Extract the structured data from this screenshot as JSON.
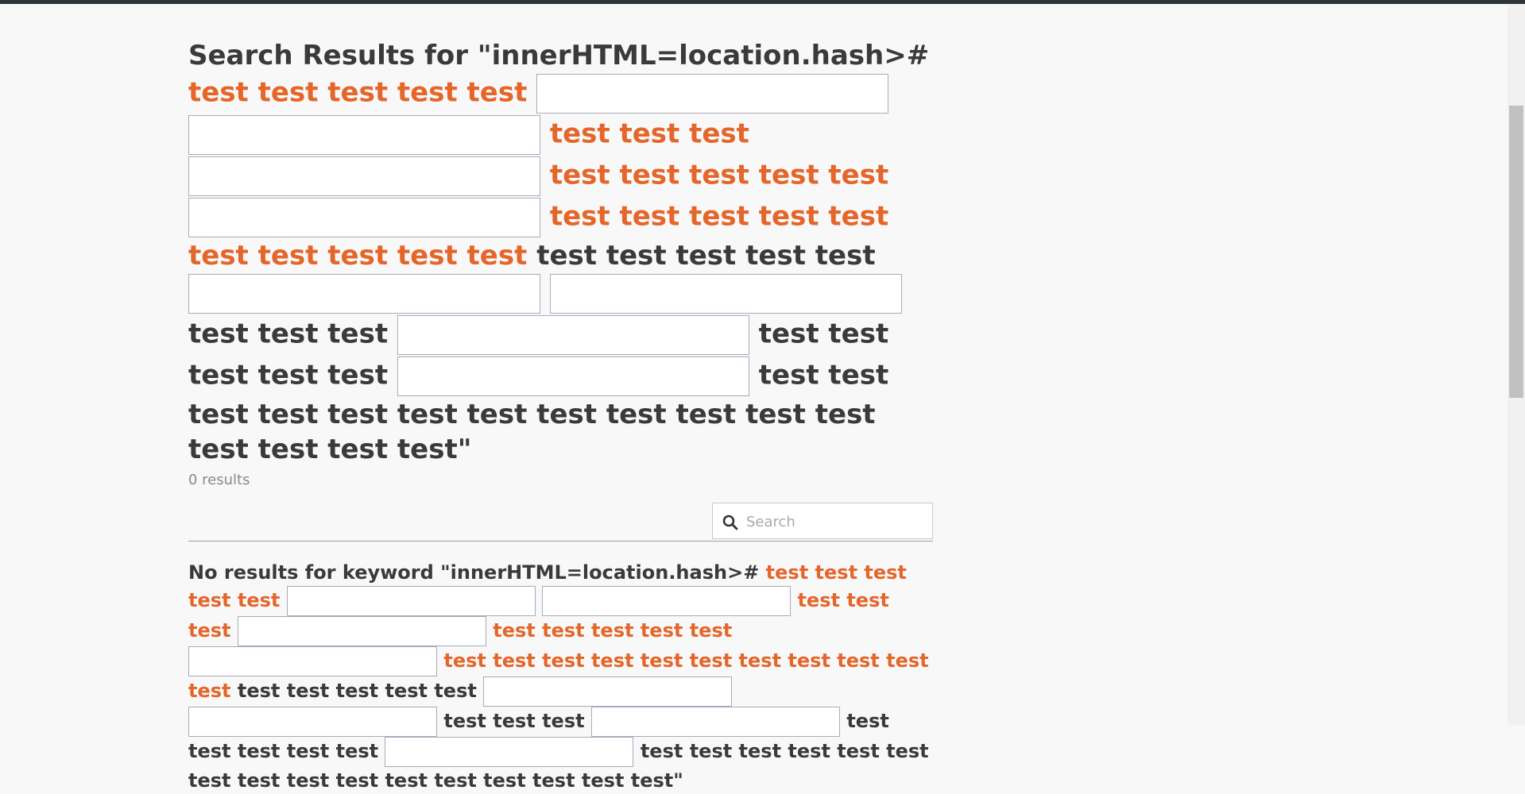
{
  "heading": {
    "prefix": "Search Results for \"innerHTML=location.hash>#",
    "segments": [
      "test test test test test",
      "test test test",
      "test test test test test",
      "test test test test test test test test test test",
      "test test test test test",
      "test test test",
      "test test test",
      "test test",
      "test test test test test test test test test test test test test test test test\""
    ]
  },
  "results_count": "0 results",
  "search": {
    "placeholder": "Search"
  },
  "no_results": {
    "prefix": "No results for keyword \"innerHTML=location.hash>#",
    "segments": [
      "test test test test test",
      "test test test",
      "test test test test test",
      "test test test test test test test test test test test",
      "test test test test test",
      "test test test",
      "test test test test test",
      "test test test test test test test test test test test test test test test test\""
    ]
  }
}
